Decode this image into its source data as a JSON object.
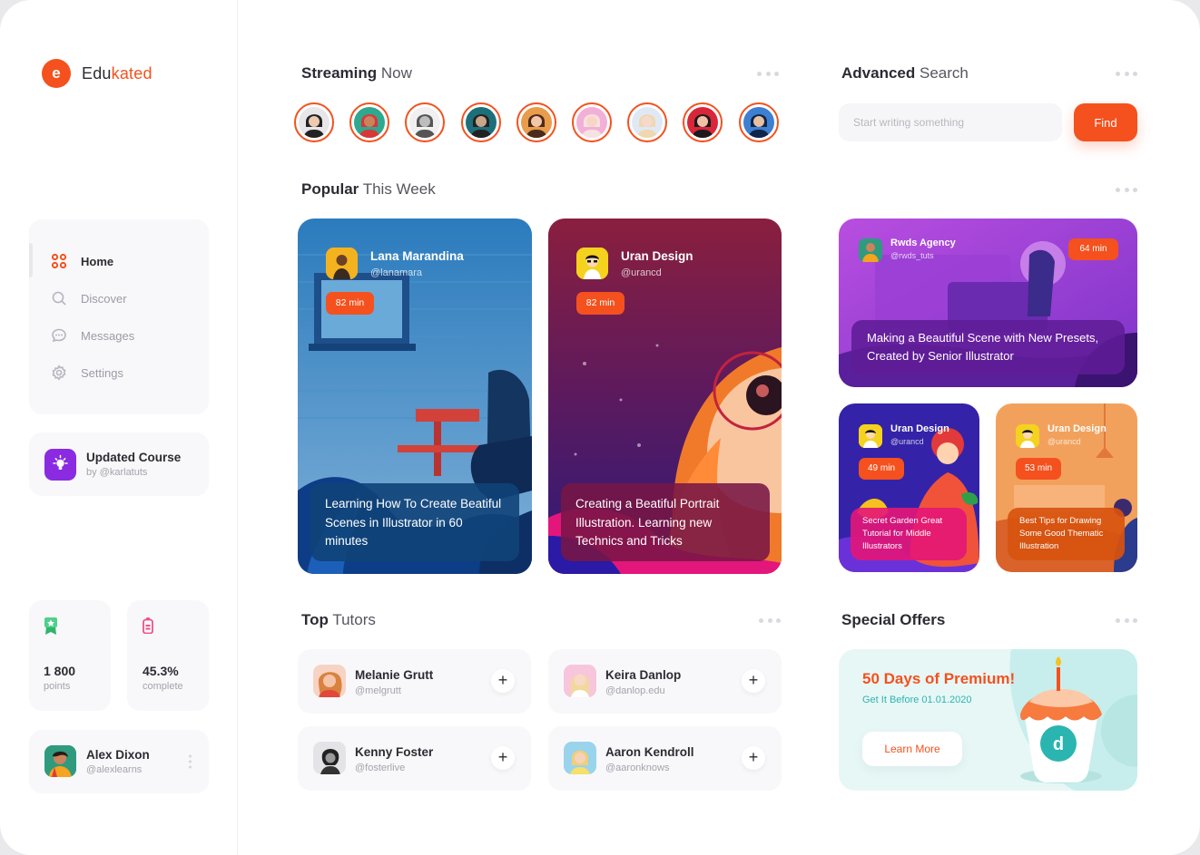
{
  "brand": {
    "prefix": "Edu",
    "accent": "kated",
    "mark": "e"
  },
  "colors": {
    "accent": "#f4511e",
    "purple": "#8a2be2",
    "teal": "#2bb5b0"
  },
  "nav": {
    "items": [
      {
        "label": "Home",
        "icon": "grid-icon",
        "active": true
      },
      {
        "label": "Discover",
        "icon": "search-icon",
        "active": false
      },
      {
        "label": "Messages",
        "icon": "chat-icon",
        "active": false
      },
      {
        "label": "Settings",
        "icon": "gear-icon",
        "active": false
      }
    ]
  },
  "updated_course": {
    "title": "Updated Course",
    "by": "by @karlatuts",
    "icon": "lightbulb-icon"
  },
  "stats": {
    "points": {
      "value": "1 800",
      "label": "points",
      "icon": "award-icon"
    },
    "complete": {
      "value": "45.3%",
      "label": "complete",
      "icon": "battery-icon"
    }
  },
  "user": {
    "name": "Alex Dixon",
    "handle": "@alexlearns"
  },
  "streaming": {
    "title_bold": "Streaming",
    "title_light": "Now",
    "count": 9
  },
  "search": {
    "title_bold": "Advanced",
    "title_light": "Search",
    "placeholder": "Start writing something",
    "button": "Find"
  },
  "popular": {
    "title_bold": "Popular",
    "title_light": "This Week",
    "cards": [
      {
        "name": "Lana Marandina",
        "handle": "@lanamara",
        "duration": "82 min",
        "caption": "Learning How To Create Beatiful Scenes in Illustrator in 60 minutes"
      },
      {
        "name": "Uran Design",
        "handle": "@urancd",
        "duration": "82 min",
        "caption": "Creating a Beatiful Portrait Illustration. Learning new Technics and Tricks"
      },
      {
        "name": "Rwds Agency",
        "handle": "@rwds_tuts",
        "duration": "64 min",
        "caption": "Making a Beautiful Scene with New Presets, Created by Senior Illustrator"
      },
      {
        "name": "Uran Design",
        "handle": "@urancd",
        "duration": "49 min",
        "caption": "Secret Garden Great Tutorial for Middle Illustrators"
      },
      {
        "name": "Uran Design",
        "handle": "@urancd",
        "duration": "53 min",
        "caption": "Best Tips for Drawing Some Good Thematic Illustration"
      }
    ]
  },
  "tutors": {
    "title_bold": "Top",
    "title_light": "Tutors",
    "items": [
      {
        "name": "Melanie Grutt",
        "handle": "@melgrutt"
      },
      {
        "name": "Keira Danlop",
        "handle": "@danlop.edu"
      },
      {
        "name": "Kenny Foster",
        "handle": "@fosterlive"
      },
      {
        "name": "Aaron Kendroll",
        "handle": "@aaronknows"
      }
    ]
  },
  "offers": {
    "title": "Special Offers",
    "headline": "50 Days of Premium!",
    "sub": "Get It Before 01.01.2020",
    "button": "Learn More",
    "cake_letter": "d"
  }
}
